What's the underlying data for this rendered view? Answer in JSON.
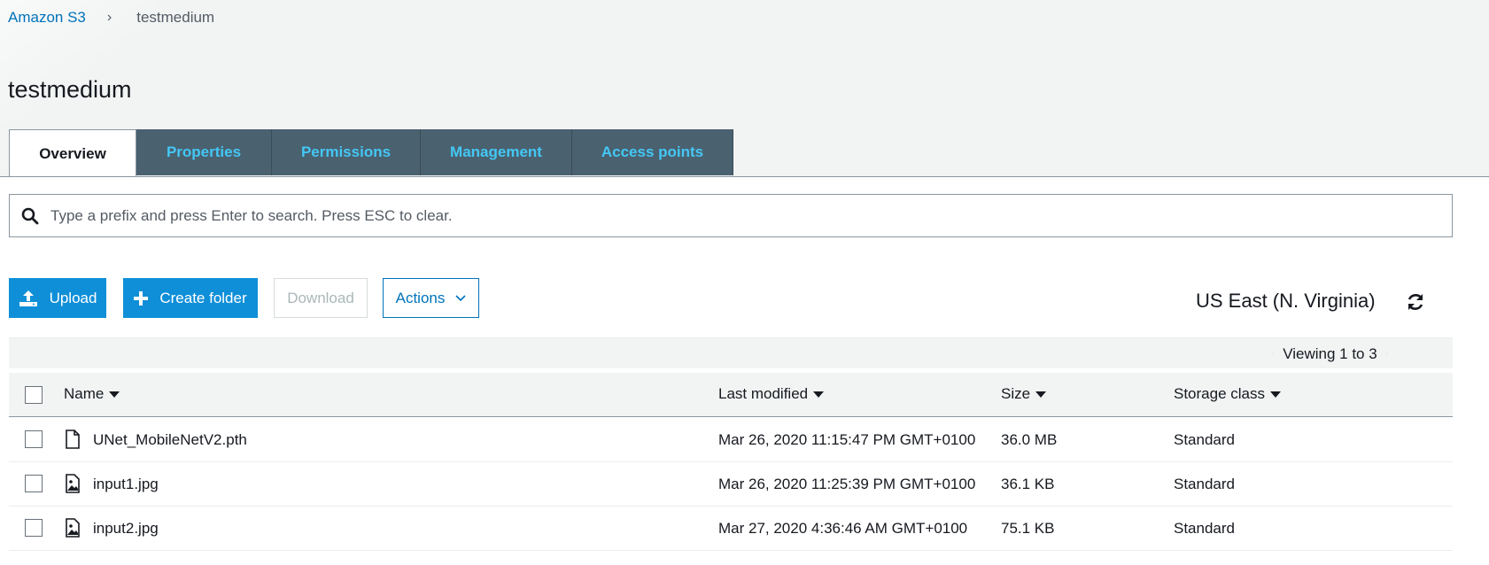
{
  "breadcrumb": {
    "root": "Amazon S3",
    "separator": "›",
    "current": "testmedium"
  },
  "page_title": "testmedium",
  "tabs": [
    {
      "label": "Overview",
      "active": true
    },
    {
      "label": "Properties",
      "active": false
    },
    {
      "label": "Permissions",
      "active": false
    },
    {
      "label": "Management",
      "active": false
    },
    {
      "label": "Access points",
      "active": false
    }
  ],
  "search": {
    "placeholder": "Type a prefix and press Enter to search. Press ESC to clear.",
    "value": ""
  },
  "toolbar": {
    "upload": "Upload",
    "create_folder": "Create folder",
    "download": "Download",
    "actions": "Actions"
  },
  "region": "US East (N. Virginia)",
  "pagination": {
    "text": "Viewing 1 to 3"
  },
  "columns": {
    "name": "Name",
    "last_modified": "Last modified",
    "size": "Size",
    "storage_class": "Storage class"
  },
  "objects": [
    {
      "name": "UNet_MobileNetV2.pth",
      "icon": "file-icon",
      "last_modified": "Mar 26, 2020 11:15:47 PM GMT+0100",
      "size": "36.0 MB",
      "storage_class": "Standard"
    },
    {
      "name": "input1.jpg",
      "icon": "image-file-icon",
      "last_modified": "Mar 26, 2020 11:25:39 PM GMT+0100",
      "size": "36.1 KB",
      "storage_class": "Standard"
    },
    {
      "name": "input2.jpg",
      "icon": "image-file-icon",
      "last_modified": "Mar 27, 2020 4:36:46 AM GMT+0100",
      "size": "75.1 KB",
      "storage_class": "Standard"
    }
  ],
  "colors": {
    "link": "#0073bb",
    "primary": "#0f8fd8",
    "tab_bg": "#4a6170",
    "tab_text": "#44c7f4"
  }
}
